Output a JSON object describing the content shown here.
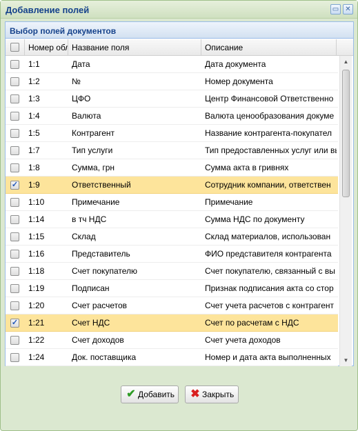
{
  "window": {
    "title": "Добавление полей",
    "minimize_glyph": "▭",
    "close_glyph": "✕"
  },
  "panel": {
    "title": "Выбор полей документов"
  },
  "columns": {
    "number": "Номер обл",
    "name": "Название поля",
    "description": "Описание"
  },
  "rows": [
    {
      "number": "1:1",
      "name": "Дата",
      "description": "Дата документа",
      "checked": false
    },
    {
      "number": "1:2",
      "name": "№",
      "description": "Номер документа",
      "checked": false
    },
    {
      "number": "1:3",
      "name": "ЦФО",
      "description": "Центр Финансовой Ответственно",
      "checked": false
    },
    {
      "number": "1:4",
      "name": "Валюта",
      "description": "Валюта ценообразования докуме",
      "checked": false
    },
    {
      "number": "1:5",
      "name": "Контрагент",
      "description": "Название контрагента-покупател",
      "checked": false
    },
    {
      "number": "1:7",
      "name": "Тип услуги",
      "description": "Тип предоставленных услуг или вы",
      "checked": false
    },
    {
      "number": "1:8",
      "name": "Сумма, грн",
      "description": "Сумма акта в гривнях",
      "checked": false
    },
    {
      "number": "1:9",
      "name": "Ответственный",
      "description": "Сотрудник компании, ответствен",
      "checked": true
    },
    {
      "number": "1:10",
      "name": "Примечание",
      "description": "Примечание",
      "checked": false
    },
    {
      "number": "1:14",
      "name": "в тч НДС",
      "description": "Сумма НДС по документу",
      "checked": false
    },
    {
      "number": "1:15",
      "name": "Склад",
      "description": "Склад материалов, использован",
      "checked": false
    },
    {
      "number": "1:16",
      "name": "Представитель",
      "description": "ФИО представителя контрагента",
      "checked": false
    },
    {
      "number": "1:18",
      "name": "Счет покупателю",
      "description": "Счет покупателю, связанный с вы",
      "checked": false
    },
    {
      "number": "1:19",
      "name": "Подписан",
      "description": "Признак подписания акта со стор",
      "checked": false
    },
    {
      "number": "1:20",
      "name": "Счет расчетов",
      "description": "Счет учета расчетов с контрагент",
      "checked": false
    },
    {
      "number": "1:21",
      "name": "Счет НДС",
      "description": "Счет по расчетам с НДС",
      "checked": true
    },
    {
      "number": "1:22",
      "name": "Счет доходов",
      "description": "Счет учета доходов",
      "checked": false
    },
    {
      "number": "1:24",
      "name": "Док. поставщика",
      "description": "Номер и дата акта выполненных",
      "checked": false
    }
  ],
  "scrollbar": {
    "up_glyph": "▲",
    "down_glyph": "▼"
  },
  "buttons": {
    "add_label": "Добавить",
    "add_icon": "check-icon",
    "close_label": "Закрыть",
    "close_icon": "cross-icon"
  },
  "colors": {
    "selected_row": "#fde49b",
    "header_text": "#15428b",
    "window_bg": "#dbe8d0"
  }
}
